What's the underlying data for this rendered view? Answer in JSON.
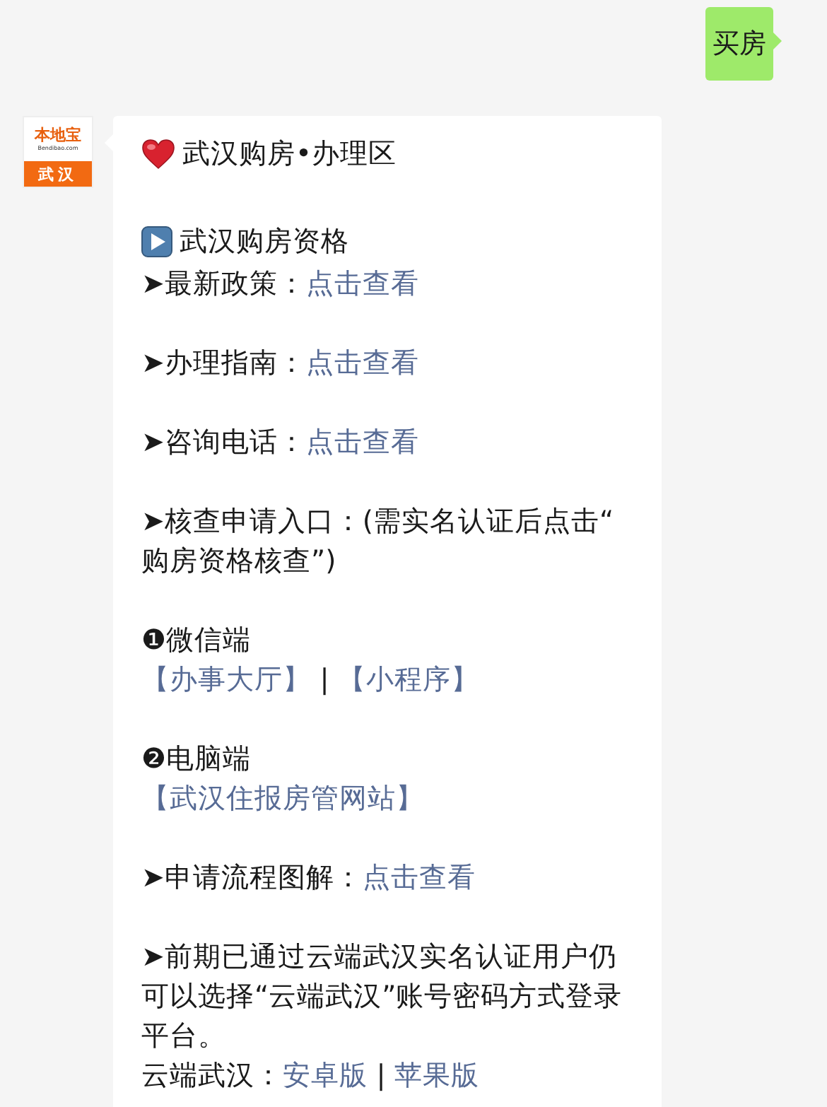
{
  "outgoing_message": {
    "text": "买房"
  },
  "incoming_message": {
    "avatar": {
      "brand": "本地宝",
      "domain": "Bendibao.com",
      "city": "武汉"
    },
    "paragraphs": [
      [
        {
          "kind": "title",
          "segments": [
            {
              "text": "武汉购房•办理区",
              "link": false
            }
          ]
        }
      ],
      [
        {
          "kind": "section",
          "segments": [
            {
              "text": "武汉购房资格",
              "link": false
            }
          ]
        },
        {
          "kind": "line",
          "segments": [
            {
              "text": "➤最新政策：",
              "link": false
            },
            {
              "text": "点击查看",
              "link": true
            }
          ]
        }
      ],
      [
        {
          "kind": "line",
          "segments": [
            {
              "text": "➤办理指南：",
              "link": false
            },
            {
              "text": "点击查看",
              "link": true
            }
          ]
        }
      ],
      [
        {
          "kind": "line",
          "segments": [
            {
              "text": "➤咨询电话：",
              "link": false
            },
            {
              "text": "点击查看",
              "link": true
            }
          ]
        }
      ],
      [
        {
          "kind": "line",
          "segments": [
            {
              "text": "➤核查申请入口：(需实名认证后点击“购房资格核查”)",
              "link": false
            }
          ]
        }
      ],
      [
        {
          "kind": "line",
          "segments": [
            {
              "text": "❶微信端",
              "link": false
            }
          ]
        },
        {
          "kind": "line",
          "segments": [
            {
              "text": "【办事大厅】",
              "link": true
            },
            {
              "text": " | ",
              "link": false
            },
            {
              "text": "【小程序】",
              "link": true
            }
          ]
        }
      ],
      [
        {
          "kind": "line",
          "segments": [
            {
              "text": "❷电脑端",
              "link": false
            }
          ]
        },
        {
          "kind": "line",
          "segments": [
            {
              "text": "【武汉住报房管网站】",
              "link": true
            }
          ]
        }
      ],
      [
        {
          "kind": "line",
          "segments": [
            {
              "text": "➤申请流程图解：",
              "link": false
            },
            {
              "text": "点击查看",
              "link": true
            }
          ]
        }
      ],
      [
        {
          "kind": "line",
          "segments": [
            {
              "text": "➤前期已通过云端武汉实名认证用户仍可以选择“云端武汉”账号密码方式登录平台。",
              "link": false
            }
          ]
        },
        {
          "kind": "line",
          "segments": [
            {
              "text": "云端武汉：",
              "link": false
            },
            {
              "text": "安卓版",
              "link": true
            },
            {
              "text": " | ",
              "link": false
            },
            {
              "text": "苹果版",
              "link": true
            }
          ]
        }
      ]
    ]
  }
}
